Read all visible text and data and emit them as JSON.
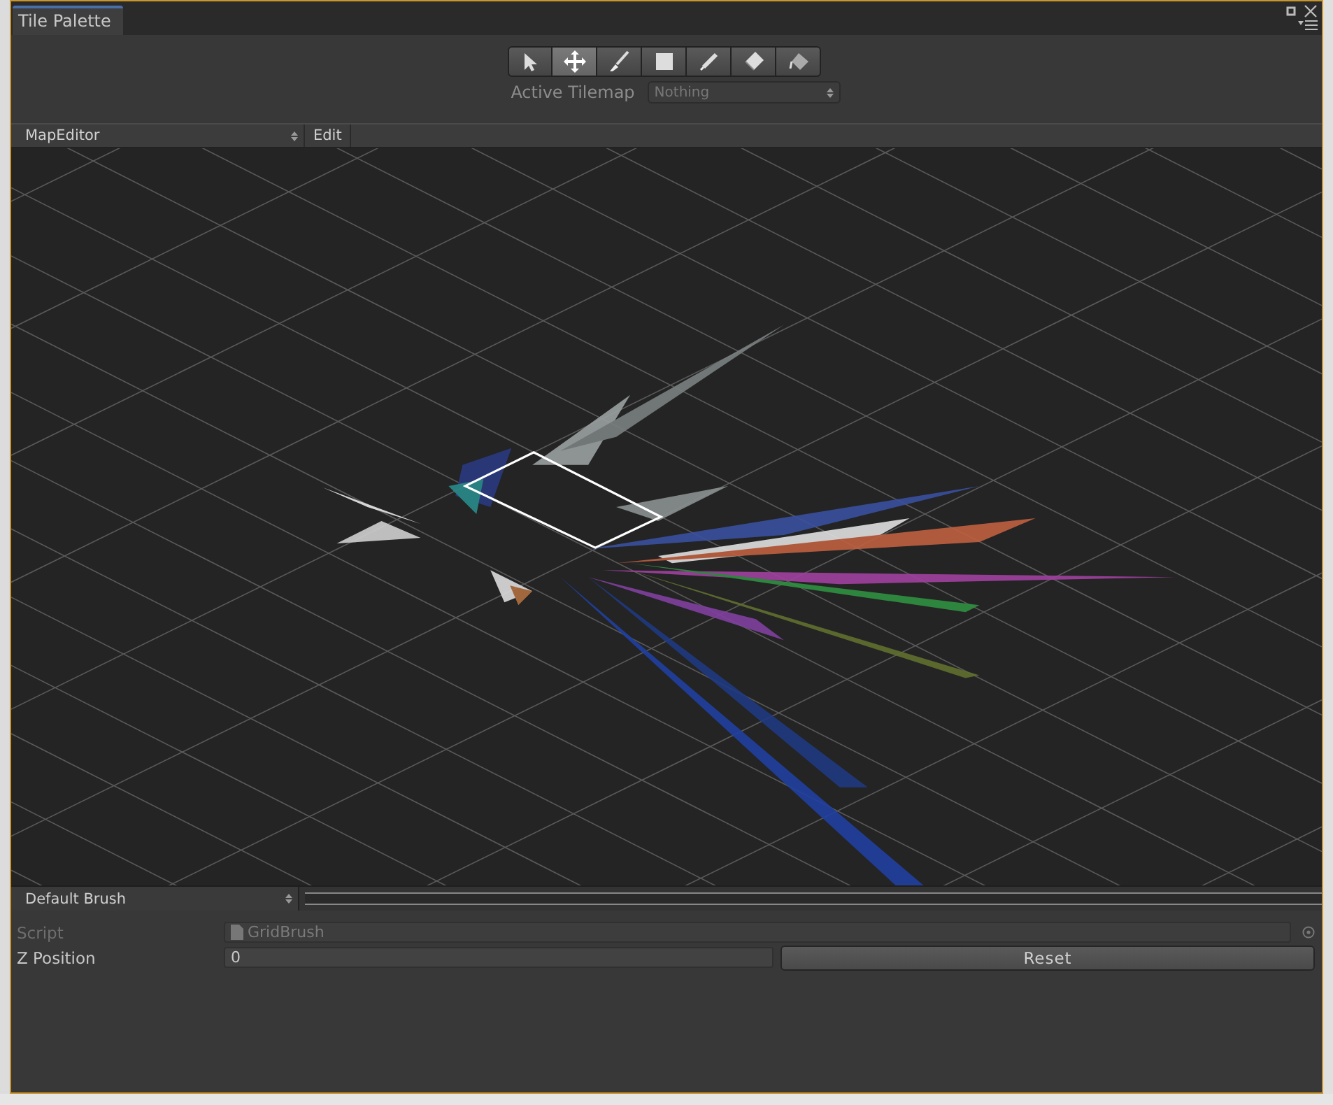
{
  "window": {
    "tab": "Tile Palette"
  },
  "tools": [
    {
      "kind": "select",
      "selected": false
    },
    {
      "kind": "move",
      "selected": true
    },
    {
      "kind": "paint",
      "selected": false
    },
    {
      "kind": "box",
      "selected": false
    },
    {
      "kind": "picker",
      "selected": false
    },
    {
      "kind": "erase",
      "selected": false
    },
    {
      "kind": "fill",
      "selected": false
    }
  ],
  "active_tilemap": {
    "label": "Active Tilemap",
    "value": "Nothing",
    "disabled": true
  },
  "palette": {
    "name": "MapEditor",
    "edit_button": "Edit"
  },
  "brush": {
    "name": "Default Brush"
  },
  "properties": [
    {
      "kind": "object",
      "label": "Script",
      "value": "GridBrush",
      "disabled": true
    },
    {
      "kind": "number",
      "label": "Z Position",
      "value": "0",
      "disabled": false
    }
  ],
  "reset_button": "Reset"
}
